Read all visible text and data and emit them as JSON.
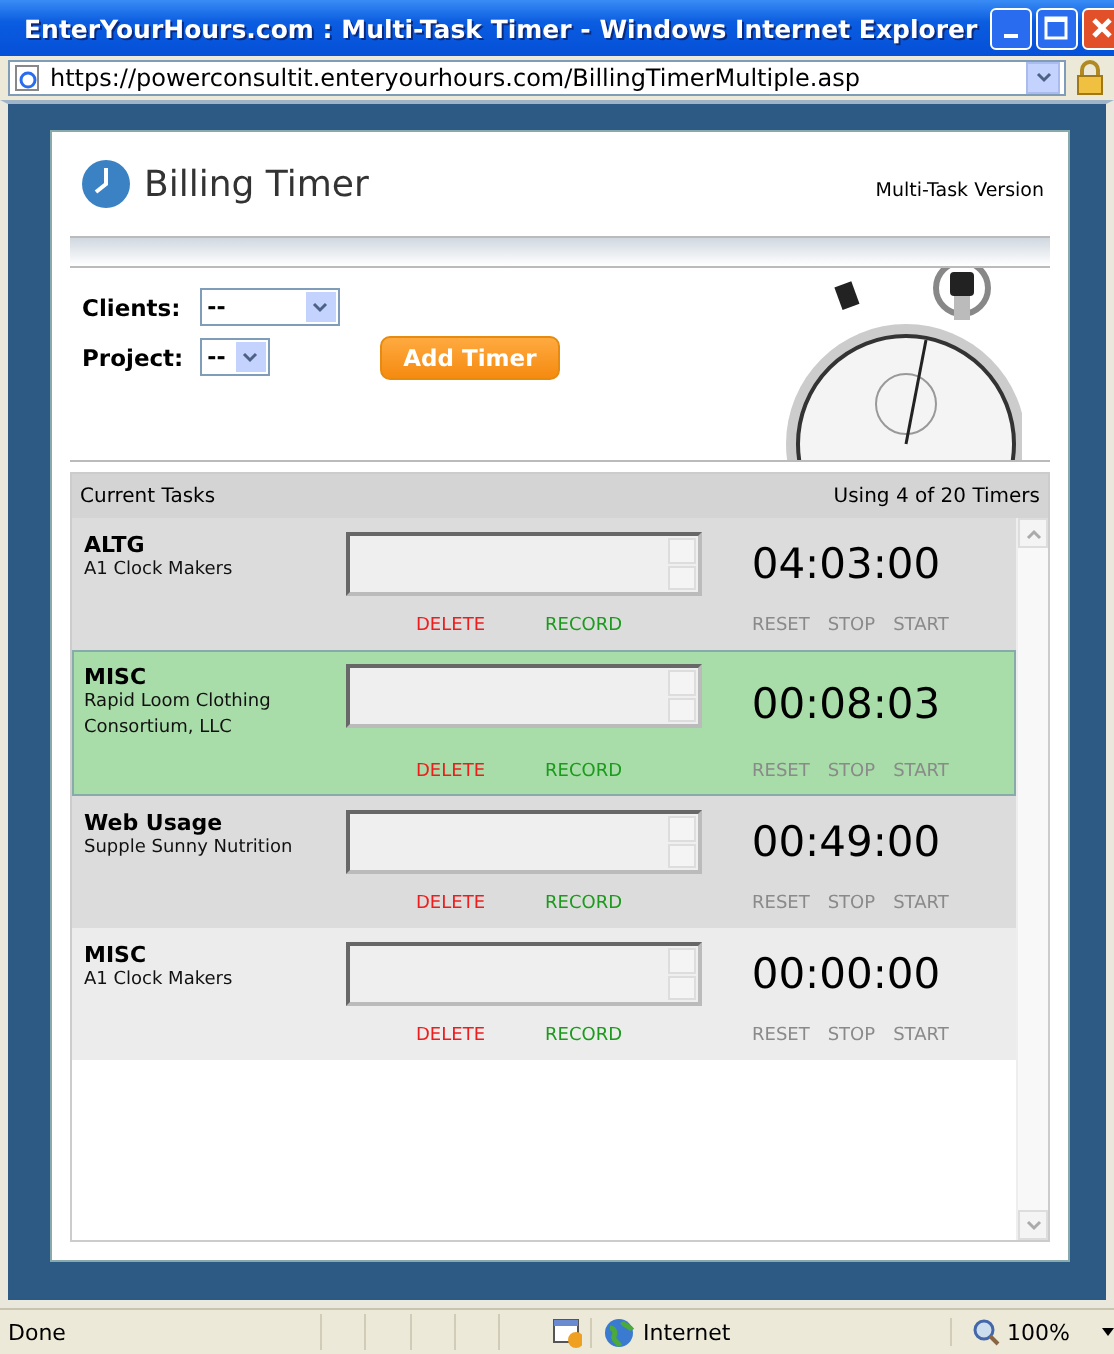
{
  "window": {
    "title": "EnterYourHours.com : Multi-Task Timer - Windows Internet Explorer"
  },
  "address_bar": {
    "url": "https://powerconsultit.enteryourhours.com/BillingTimerMultiple.asp"
  },
  "header": {
    "title": "Billing Timer",
    "version": "Multi-Task Version"
  },
  "form": {
    "fields": [
      {
        "label": "Clients:",
        "value": "--",
        "kind": "wide"
      },
      {
        "label": "Project:",
        "value": "--",
        "kind": "narrow"
      }
    ],
    "add_button": "Add Timer"
  },
  "tasks": {
    "title": "Current Tasks",
    "usage": "Using 4 of 20 Timers",
    "items": [
      {
        "name": "ALTG",
        "client": "A1 Clock Makers",
        "time": "04:03:00",
        "selected": false,
        "buttons": [
          {
            "label": "DELETE",
            "kind": "delete"
          },
          {
            "label": "RECORD",
            "kind": "record"
          },
          {
            "label": "RESET",
            "kind": "control"
          },
          {
            "label": "STOP",
            "kind": "control"
          },
          {
            "label": "START",
            "kind": "control"
          }
        ]
      },
      {
        "name": "MISC",
        "client": "Rapid Loom Clothing Consortium, LLC",
        "time": "00:08:03",
        "selected": true,
        "buttons": [
          {
            "label": "DELETE",
            "kind": "delete"
          },
          {
            "label": "RECORD",
            "kind": "record"
          },
          {
            "label": "RESET",
            "kind": "control"
          },
          {
            "label": "STOP",
            "kind": "control"
          },
          {
            "label": "START",
            "kind": "control"
          }
        ]
      },
      {
        "name": "Web Usage",
        "client": "Supple Sunny Nutrition",
        "time": "00:49:00",
        "selected": false,
        "buttons": [
          {
            "label": "DELETE",
            "kind": "delete"
          },
          {
            "label": "RECORD",
            "kind": "record"
          },
          {
            "label": "RESET",
            "kind": "control"
          },
          {
            "label": "STOP",
            "kind": "control"
          },
          {
            "label": "START",
            "kind": "control"
          }
        ]
      },
      {
        "name": "MISC",
        "client": "A1 Clock Makers",
        "time": "00:00:00",
        "selected": false,
        "buttons": [
          {
            "label": "DELETE",
            "kind": "delete"
          },
          {
            "label": "RECORD",
            "kind": "record"
          },
          {
            "label": "RESET",
            "kind": "control"
          },
          {
            "label": "STOP",
            "kind": "control"
          },
          {
            "label": "START",
            "kind": "control"
          }
        ]
      }
    ]
  },
  "status_bar": {
    "text": "Done",
    "zone": "Internet",
    "zoom": "100%"
  }
}
